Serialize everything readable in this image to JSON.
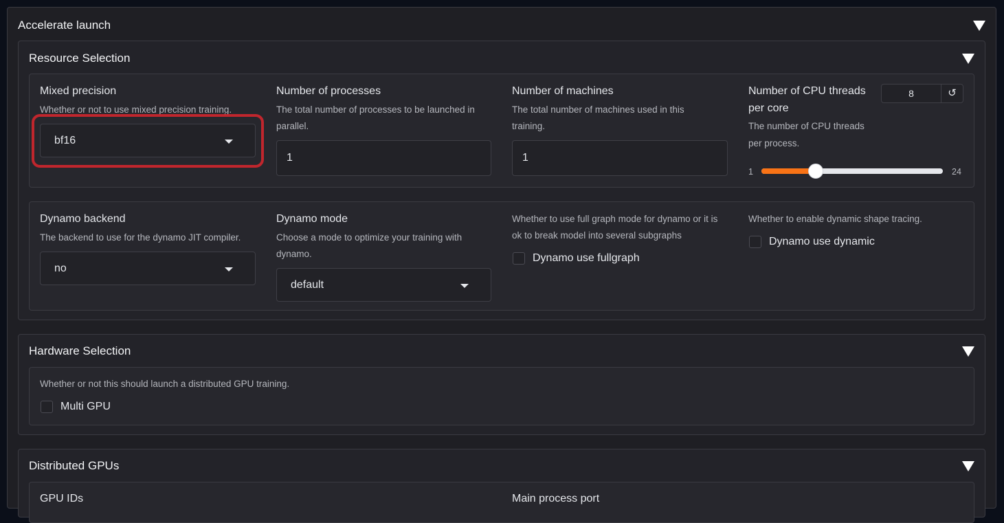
{
  "accelerate_launch": {
    "title": "Accelerate launch",
    "resource_selection": {
      "title": "Resource Selection",
      "mixed_precision": {
        "label": "Mixed precision",
        "info": "Whether or not to use mixed precision training.",
        "value": "bf16"
      },
      "num_processes": {
        "label": "Number of processes",
        "info_line1": "The total number of processes to be launched in",
        "info_line2": "parallel.",
        "value": "1"
      },
      "num_machines": {
        "label": "Number of machines",
        "info_line1": "The total number of machines used in this",
        "info_line2": "training.",
        "value": "1"
      },
      "cpu_threads": {
        "label_line1": "Number of CPU threads",
        "label_line2": "per core",
        "info_line1": "The number of CPU threads",
        "info_line2": "per process.",
        "value": "8",
        "min": "1",
        "max": "24",
        "reset_icon": "reset-icon",
        "slider_fraction": 0.3
      },
      "dynamo_backend": {
        "label": "Dynamo backend",
        "info": "The backend to use for the dynamo JIT compiler.",
        "value": "no"
      },
      "dynamo_mode": {
        "label": "Dynamo mode",
        "info_line1": "Choose a mode to optimize your training with",
        "info_line2": "dynamo.",
        "value": "default"
      },
      "dynamo_fullgraph": {
        "info_line1": "Whether to use full graph mode for dynamo or it is",
        "info_line2": "ok to break model into several subgraphs",
        "label": "Dynamo use fullgraph"
      },
      "dynamo_dynamic": {
        "info": "Whether to enable dynamic shape tracing.",
        "label": "Dynamo use dynamic"
      }
    },
    "hardware_selection": {
      "title": "Hardware Selection",
      "info": "Whether or not this should launch a distributed GPU training.",
      "multi_gpu_label": "Multi GPU"
    },
    "distributed_gpus": {
      "title": "Distributed GPUs",
      "gpu_ids_label": "GPU IDs",
      "main_process_port_label": "Main process port"
    }
  },
  "colors": {
    "accent": "#f97316",
    "highlight": "#c0262d"
  }
}
